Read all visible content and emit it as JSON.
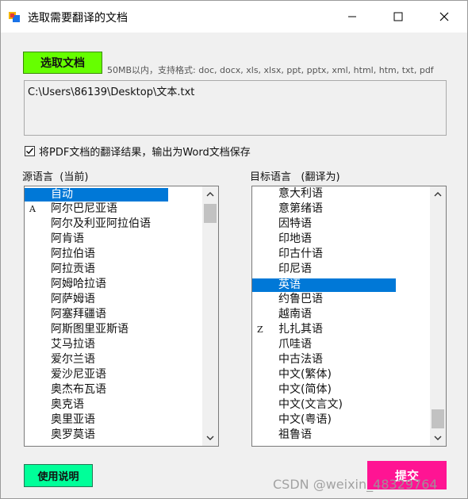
{
  "window": {
    "title": "选取需要翻译的文档",
    "icon": "app-window-icon"
  },
  "toolbar": {
    "select_label": "选取文档",
    "hint": "50MB以内，支持格式: doc, docx, xls, xlsx, ppt, pptx, xml, html, htm, txt, pdf"
  },
  "file": {
    "path": "C:\\Users\\86139\\Desktop\\文本.txt"
  },
  "option": {
    "checked": true,
    "label": "将PDF文档的翻译结果，输出为Word文档保存"
  },
  "source": {
    "label": "源语言  (当前)",
    "items": [
      {
        "key": "",
        "text": "自动",
        "selected": true
      },
      {
        "key": "A",
        "text": "阿尔巴尼亚语",
        "selected": false
      },
      {
        "key": "",
        "text": "阿尔及利亚阿拉伯语",
        "selected": false
      },
      {
        "key": "",
        "text": "阿肯语",
        "selected": false
      },
      {
        "key": "",
        "text": "阿拉伯语",
        "selected": false
      },
      {
        "key": "",
        "text": "阿拉贡语",
        "selected": false
      },
      {
        "key": "",
        "text": "阿姆哈拉语",
        "selected": false
      },
      {
        "key": "",
        "text": "阿萨姆语",
        "selected": false
      },
      {
        "key": "",
        "text": "阿塞拜疆语",
        "selected": false
      },
      {
        "key": "",
        "text": "阿斯图里亚斯语",
        "selected": false
      },
      {
        "key": "",
        "text": "艾马拉语",
        "selected": false
      },
      {
        "key": "",
        "text": "爱尔兰语",
        "selected": false
      },
      {
        "key": "",
        "text": "爱沙尼亚语",
        "selected": false
      },
      {
        "key": "",
        "text": "奥杰布瓦语",
        "selected": false
      },
      {
        "key": "",
        "text": "奥克语",
        "selected": false
      },
      {
        "key": "",
        "text": "奥里亚语",
        "selected": false
      },
      {
        "key": "",
        "text": "奥罗莫语",
        "selected": false
      }
    ],
    "scroll_fraction": 0.0
  },
  "target": {
    "label": "目标语言   (翻译为)",
    "items": [
      {
        "key": "",
        "text": "意大利语",
        "selected": false
      },
      {
        "key": "",
        "text": "意第绪语",
        "selected": false
      },
      {
        "key": "",
        "text": "因特语",
        "selected": false
      },
      {
        "key": "",
        "text": "印地语",
        "selected": false
      },
      {
        "key": "",
        "text": "印古什语",
        "selected": false
      },
      {
        "key": "",
        "text": "印尼语",
        "selected": false
      },
      {
        "key": "",
        "text": "英语",
        "selected": true
      },
      {
        "key": "",
        "text": "约鲁巴语",
        "selected": false
      },
      {
        "key": "",
        "text": "越南语",
        "selected": false
      },
      {
        "key": "Z",
        "text": "扎扎其语",
        "selected": false
      },
      {
        "key": "",
        "text": "爪哇语",
        "selected": false
      },
      {
        "key": "",
        "text": "中古法语",
        "selected": false
      },
      {
        "key": "",
        "text": "中文(繁体)",
        "selected": false
      },
      {
        "key": "",
        "text": "中文(简体)",
        "selected": false
      },
      {
        "key": "",
        "text": "中文(文言文)",
        "selected": false
      },
      {
        "key": "",
        "text": "中文(粤语)",
        "selected": false
      },
      {
        "key": "",
        "text": "祖鲁语",
        "selected": false
      }
    ],
    "scroll_fraction": 1.0
  },
  "footer": {
    "help_label": "使用说明",
    "submit_label": "提交",
    "watermark": "CSDN @weixin_48329764"
  },
  "colors": {
    "select_button": "#66ff00",
    "help_button": "#00ff99",
    "submit_button": "#ff1493",
    "selection": "#0078d7"
  }
}
